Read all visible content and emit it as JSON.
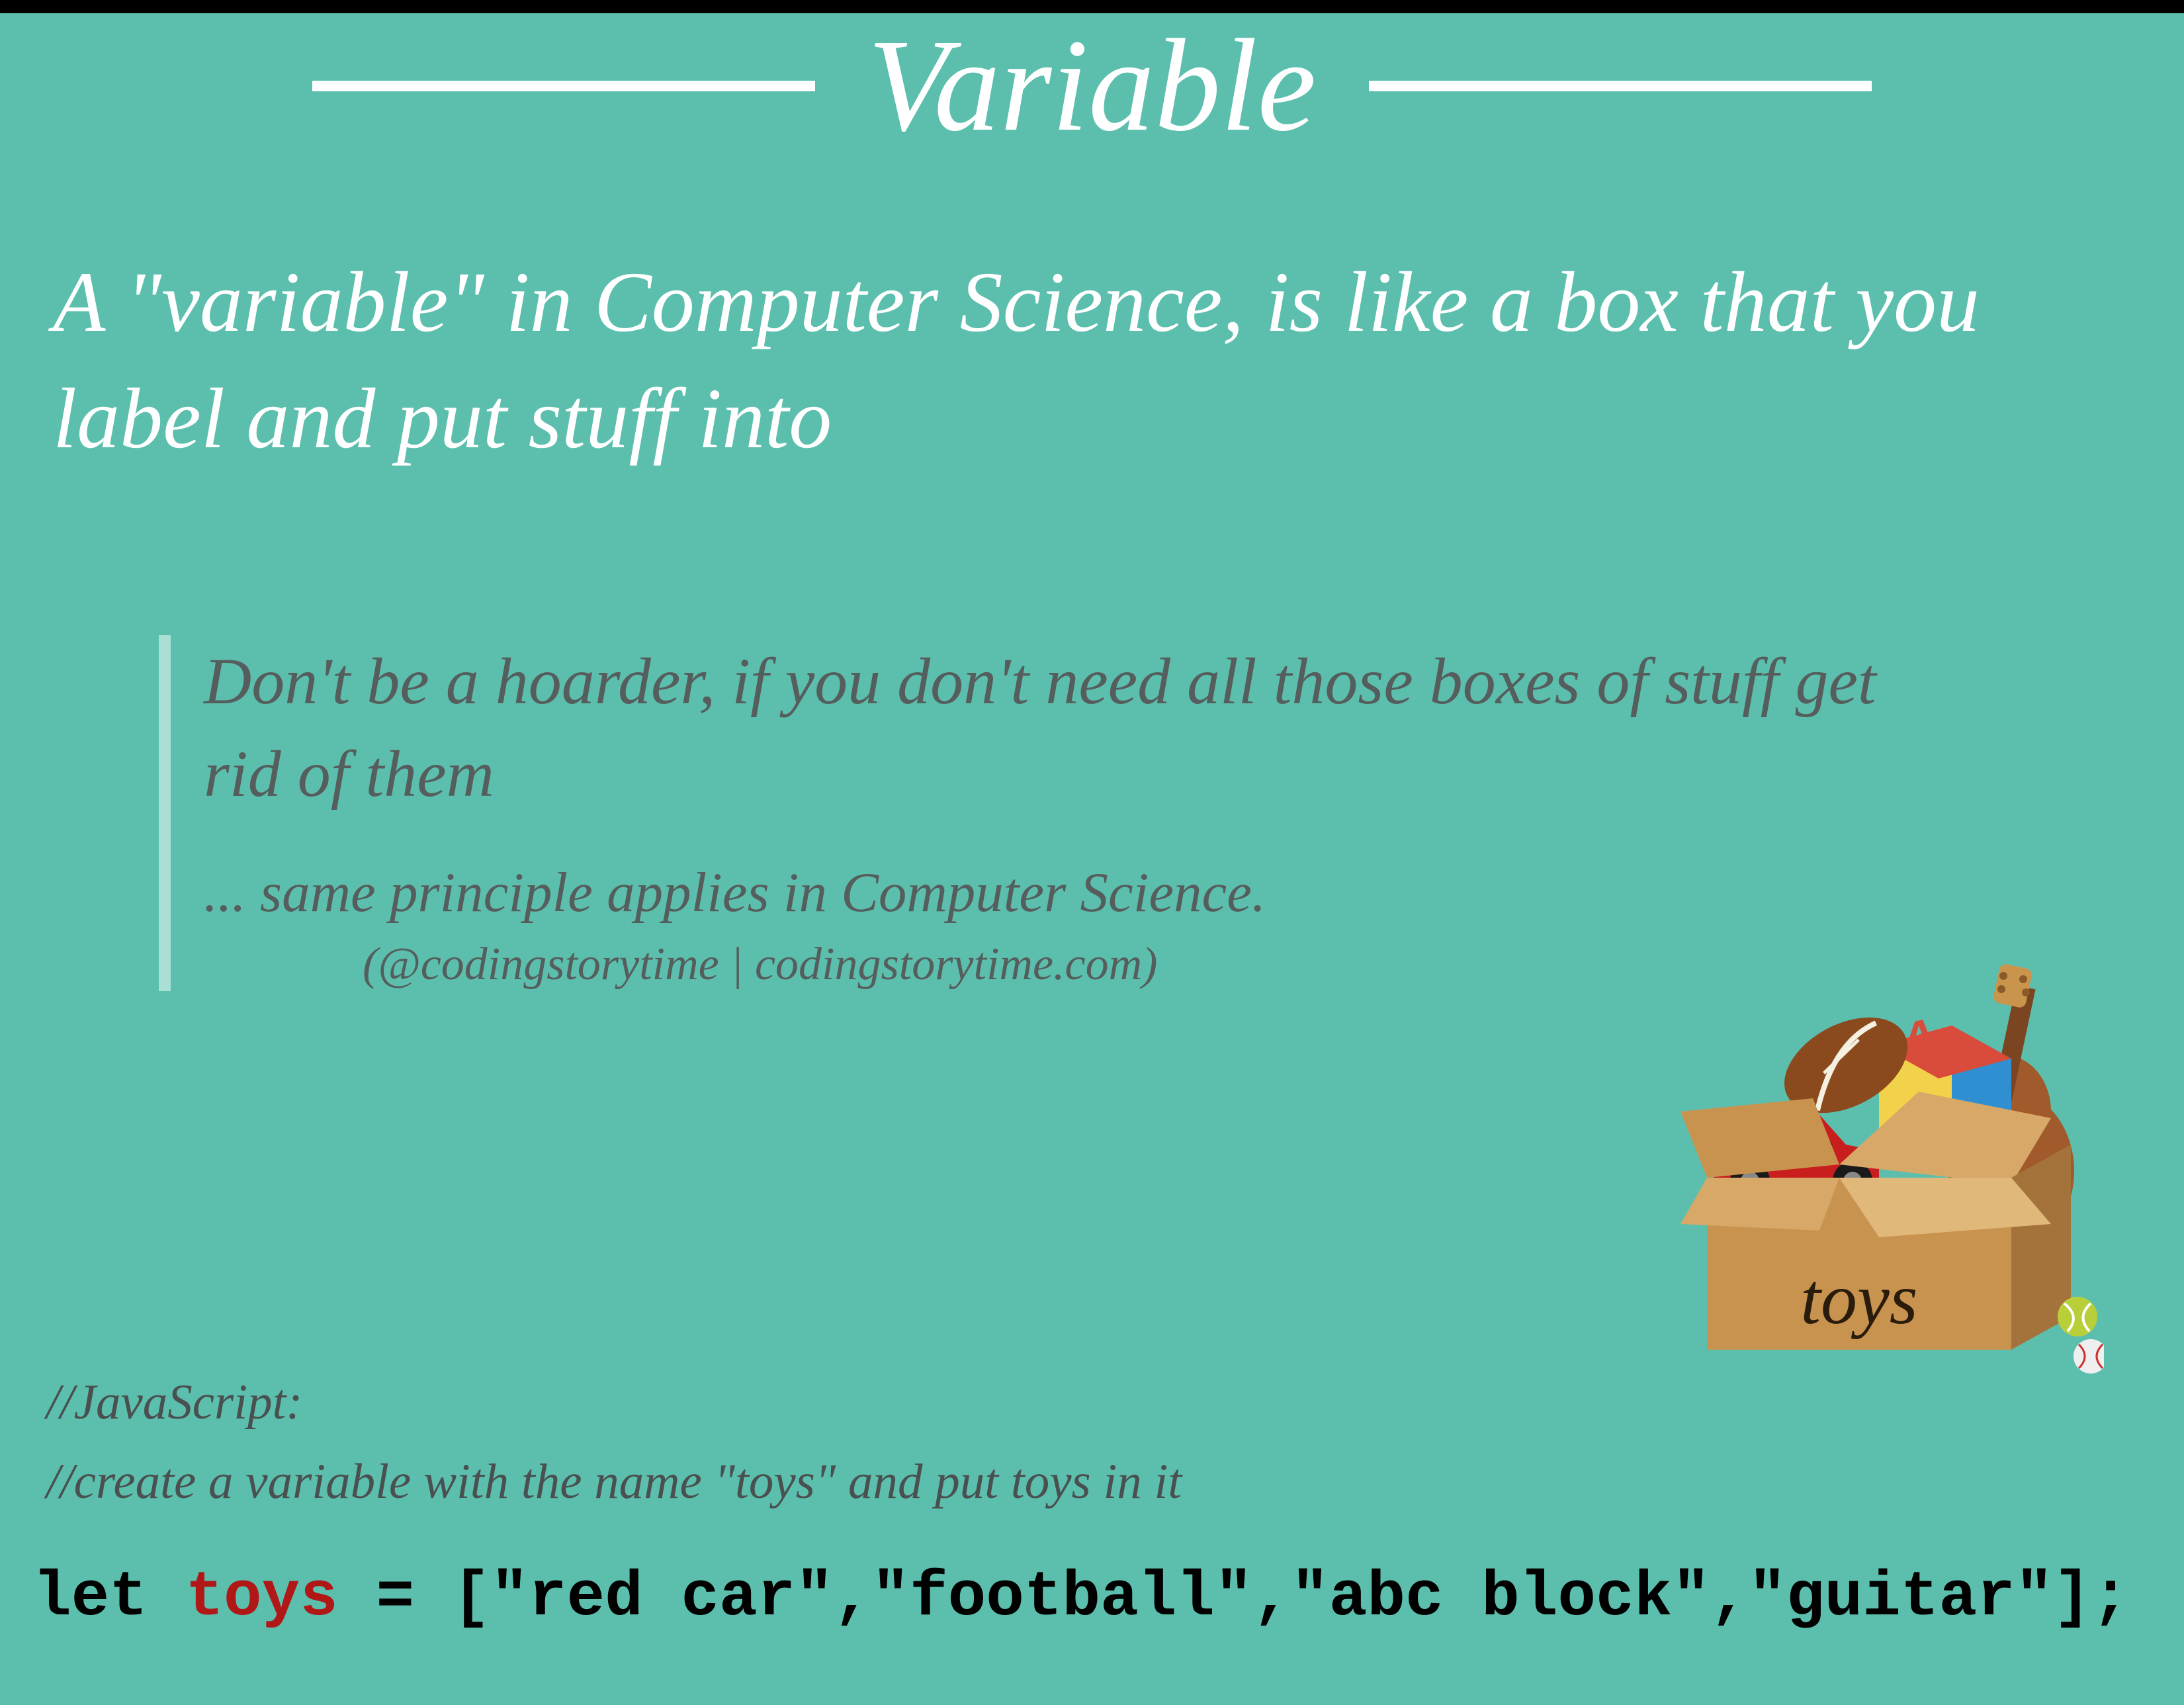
{
  "title": "Variable",
  "subtitle": "A \"variable\" in Computer Science, is like a box that you label and put stuff into",
  "quote": {
    "main": "Don't be a hoarder, if you don't need all those boxes of stuff get rid of them",
    "sub": "... same principle applies in Computer Science.",
    "attribution": "(@codingstorytime | codingstorytime.com)"
  },
  "comments": {
    "line1": "//JavaScript:",
    "line2": "//create a variable with the name \"toys\" and put toys in it"
  },
  "code": {
    "keyword": "let ",
    "varname": "toys",
    "rest": " = [\"red car\",\"football\",\"abc block\",\"guitar\"];"
  },
  "box_label": "toys"
}
